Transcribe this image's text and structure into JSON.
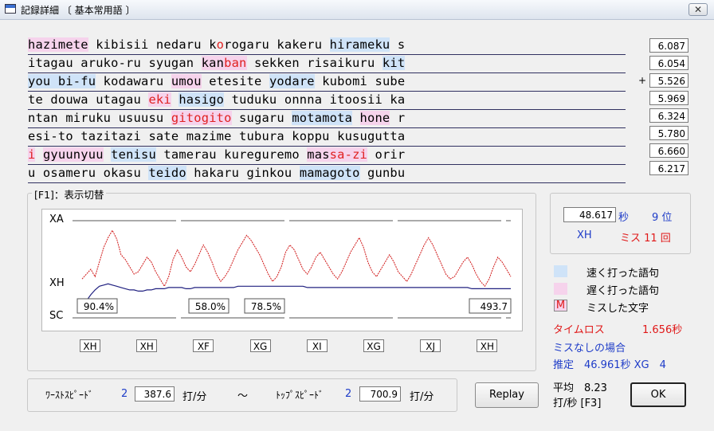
{
  "window": {
    "title": "記録詳細 〔 基本常用語 〕",
    "close_label": "✕"
  },
  "text_lines": [
    [
      {
        "t": "hazimete",
        "s": "slow"
      },
      {
        "t": " kibisii nedaru k"
      },
      {
        "t": "o",
        "s": "miss"
      },
      {
        "t": "rogaru kakeru "
      },
      {
        "t": "hirameku",
        "s": "fast"
      },
      {
        "t": " s"
      }
    ],
    [
      {
        "t": "itagau aruko-ru syugan "
      },
      {
        "t": "kan",
        "s": "slow"
      },
      {
        "t": "ban",
        "s": "slowmiss"
      },
      {
        "t": " sekken risaikuru "
      },
      {
        "t": "kit",
        "s": "fast"
      }
    ],
    [
      {
        "t": "you bi-fu",
        "s": "fast"
      },
      {
        "t": " kodawaru "
      },
      {
        "t": "umou",
        "s": "slow"
      },
      {
        "t": " etesite "
      },
      {
        "t": "yodare",
        "s": "fast"
      },
      {
        "t": " kubomi sube"
      }
    ],
    [
      {
        "t": "te douwa utagau "
      },
      {
        "t": "eki",
        "s": "slowmiss"
      },
      {
        "t": " "
      },
      {
        "t": "hasigo",
        "s": "fast"
      },
      {
        "t": " tuduku onnna itoosii ka"
      }
    ],
    [
      {
        "t": "ntan miruku usuusu "
      },
      {
        "t": "gitogito",
        "s": "slowmiss"
      },
      {
        "t": " sugaru "
      },
      {
        "t": "motamota",
        "s": "fast"
      },
      {
        "t": " "
      },
      {
        "t": "hone",
        "s": "slow"
      },
      {
        "t": " r"
      }
    ],
    [
      {
        "t": "esi-to tazitazi sate mazime tubura koppu kusugutta"
      }
    ],
    [
      {
        "t": "i",
        "s": "slowmiss"
      },
      {
        "t": " "
      },
      {
        "t": "gyuunyuu",
        "s": "slow"
      },
      {
        "t": " "
      },
      {
        "t": "tenisu",
        "s": "fast"
      },
      {
        "t": " tamerau kureguremo "
      },
      {
        "t": "mas",
        "s": "slow"
      },
      {
        "t": "sa-zi",
        "s": "slowmiss"
      },
      {
        "t": " orir"
      }
    ],
    [
      {
        "t": "u osameru okasu "
      },
      {
        "t": "teido",
        "s": "fast"
      },
      {
        "t": " hakaru ginkou "
      },
      {
        "t": "mamagoto",
        "s": "fast"
      },
      {
        "t": " gunbu"
      }
    ]
  ],
  "line_scores": [
    "6.087",
    "6.054",
    "5.526",
    "5.969",
    "6.324",
    "5.780",
    "6.660",
    "6.217"
  ],
  "plus_mark": "+",
  "chart_group_label": "[F1]：表示切替",
  "chart_data": {
    "type": "line",
    "y_levels": [
      "XA",
      "XH",
      "SC"
    ],
    "series": [
      {
        "color": "#d01818",
        "values": [
          3.2,
          3.6,
          4.0,
          3.4,
          4.6,
          5.8,
          6.6,
          7.2,
          6.5,
          5.2,
          4.8,
          4.2,
          3.6,
          3.8,
          4.4,
          5.0,
          4.6,
          3.8,
          3.2,
          2.6,
          3.4,
          4.8,
          5.6,
          5.0,
          4.2,
          3.8,
          4.4,
          5.2,
          6.0,
          5.4,
          4.6,
          3.6,
          3.0,
          3.4,
          4.0,
          4.8,
          5.6,
          6.2,
          6.8,
          6.4,
          5.8,
          5.2,
          4.4,
          3.6,
          3.0,
          3.4,
          4.2,
          5.4,
          6.0,
          5.6,
          4.8,
          4.0,
          3.6,
          4.2,
          5.0,
          5.4,
          4.8,
          4.2,
          3.6,
          3.2,
          3.8,
          4.6,
          5.4,
          6.0,
          6.6,
          5.8,
          4.6,
          3.8,
          3.4,
          4.0,
          4.6,
          5.2,
          4.6,
          3.8,
          3.4,
          3.0,
          3.6,
          4.4,
          5.2,
          6.0,
          6.6,
          6.0,
          5.2,
          4.4,
          3.6,
          3.2,
          3.4,
          4.0,
          4.6,
          5.0,
          4.4,
          3.6,
          3.0,
          2.6,
          3.2,
          4.2,
          5.0,
          4.6,
          4.0,
          3.4
        ]
      },
      {
        "color": "#202080",
        "values": [
          1.2,
          1.4,
          1.9,
          2.3,
          2.6,
          2.7,
          2.8,
          2.7,
          2.6,
          2.5,
          2.4,
          2.3,
          2.3,
          2.2,
          2.2,
          2.3,
          2.3,
          2.4,
          2.4,
          2.4,
          2.5,
          2.5,
          2.5,
          2.5,
          2.4,
          2.4,
          2.5,
          2.5,
          2.5,
          2.5,
          2.5,
          2.5,
          2.5,
          2.5,
          2.5,
          2.5,
          2.6,
          2.6,
          2.6,
          2.6,
          2.6,
          2.6,
          2.6,
          2.6,
          2.6,
          2.6,
          2.6,
          2.6,
          2.6,
          2.6,
          2.6,
          2.6,
          2.5,
          2.5,
          2.5,
          2.5,
          2.5,
          2.5,
          2.5,
          2.5,
          2.5,
          2.5,
          2.5,
          2.5,
          2.5,
          2.5,
          2.5,
          2.5,
          2.5,
          2.5,
          2.5,
          2.5,
          2.5,
          2.5,
          2.5,
          2.5,
          2.5,
          2.5,
          2.5,
          2.5,
          2.5,
          2.5,
          2.5,
          2.5,
          2.5,
          2.5,
          2.5,
          2.5,
          2.5,
          2.5,
          2.4,
          2.4,
          2.4,
          2.4,
          2.4,
          2.4,
          2.4,
          2.4,
          2.4,
          2.4
        ]
      }
    ],
    "annotations": [
      "90.4%",
      "58.0%",
      "78.5%",
      "493.7"
    ]
  },
  "segments": [
    "XH",
    "XH",
    "XF",
    "XG",
    "XI",
    "XG",
    "XJ",
    "XH"
  ],
  "stats": {
    "time": "48.617",
    "time_unit": "秒",
    "rank": "9 位",
    "level": "XH",
    "miss": "ミス 11 回"
  },
  "legend": {
    "fast": "速く打った語句",
    "slow": "遅く打った語句",
    "miss_char": "M",
    "miss": "ミスした文字",
    "fast_color": "#cfe3f8",
    "slow_color": "#f6d3ec"
  },
  "timeloss": {
    "label": "タイムロス",
    "value": "1.656秒"
  },
  "nomiss": {
    "label": "ミスなしの場合",
    "estimate": "推定　46.961秒 XG　4"
  },
  "speed": {
    "worst_label": "ﾜｰｽﾄｽﾋﾟｰﾄﾞ",
    "worst_index": "2",
    "worst_value": "387.6",
    "unit1": "打/分",
    "tilde": "～",
    "top_label": "ﾄｯﾌﾟｽﾋﾟｰﾄﾞ",
    "top_index": "2",
    "top_value": "700.9",
    "unit2": "打/分"
  },
  "replay_label": "Replay",
  "average": {
    "line1": "平均　8.23",
    "line2": "打/秒 [F3]"
  },
  "ok_label": "OK"
}
